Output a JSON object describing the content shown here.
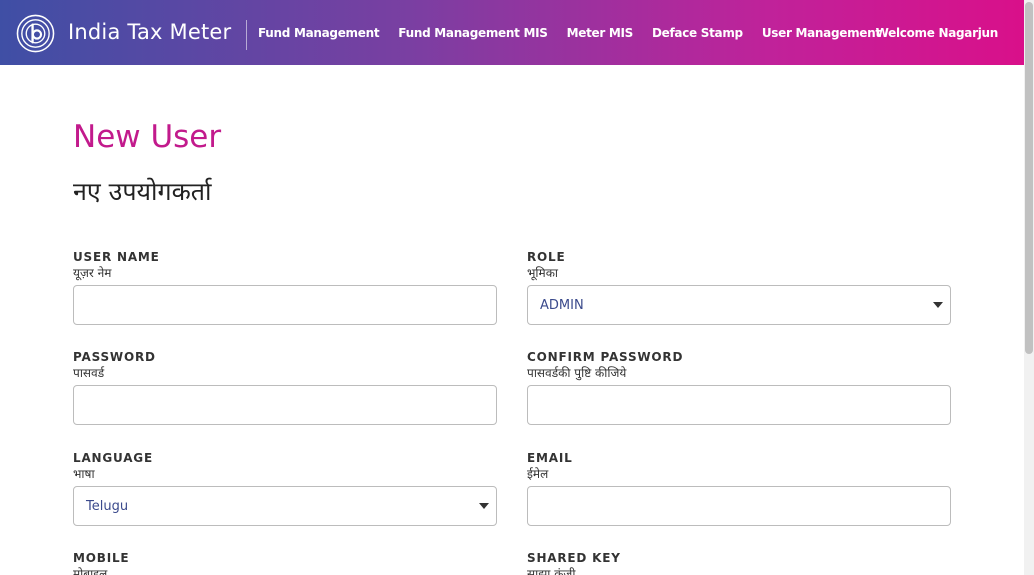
{
  "header": {
    "brand": "India Tax Meter",
    "nav": [
      "Fund Management",
      "Fund Management MIS",
      "Meter MIS",
      "Deface Stamp",
      "User Management"
    ],
    "welcome": "Welcome Nagarjun",
    "colors": {
      "gradient_start": "#3f4fa5",
      "gradient_end": "#d9108a"
    },
    "logo_icon": "pitney-bowes-logo-icon"
  },
  "page": {
    "title": "New User",
    "subtitle": "नए उपयोगकर्ता"
  },
  "form": {
    "user_name": {
      "label": "USER NAME",
      "label_hi": "यूज़र नेम",
      "value": ""
    },
    "role": {
      "label": "ROLE",
      "label_hi": "भूमिका",
      "value": "ADMIN"
    },
    "password": {
      "label": "PASSWORD",
      "label_hi": "पासवर्ड",
      "value": ""
    },
    "confirm_password": {
      "label": "CONFIRM PASSWORD",
      "label_hi": "पासवर्डकी पुष्टि कीजिये",
      "value": ""
    },
    "language": {
      "label": "LANGUAGE",
      "label_hi": "भाषा",
      "value": "Telugu"
    },
    "email": {
      "label": "EMAIL",
      "label_hi": "ईमेल",
      "value": ""
    },
    "mobile": {
      "label": "MOBILE",
      "label_hi": "मोबाइल"
    },
    "shared_key": {
      "label": "SHARED KEY",
      "label_hi": "साझा कुंजी"
    }
  },
  "accent_color": "#c21a8c"
}
